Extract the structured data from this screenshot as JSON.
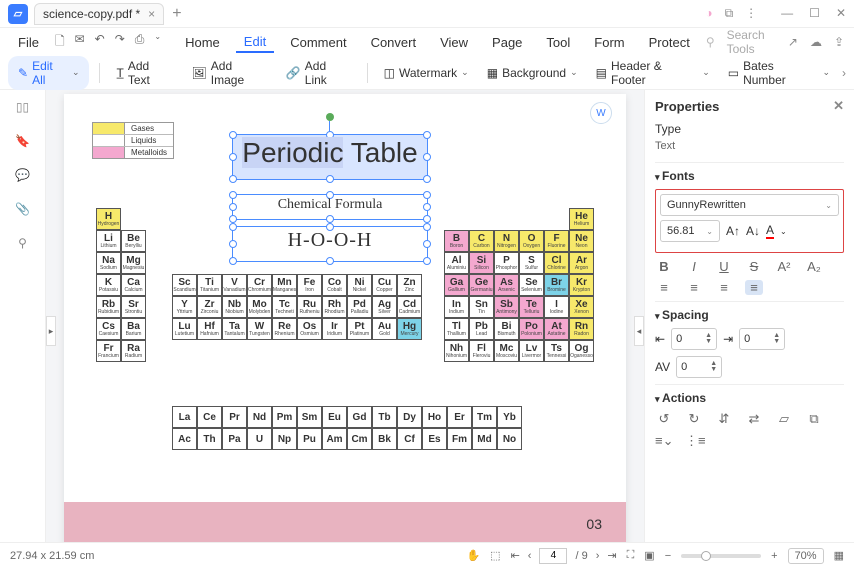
{
  "titlebar": {
    "filename": "science-copy.pdf *"
  },
  "qat": {
    "file": "File"
  },
  "menu": {
    "home": "Home",
    "edit": "Edit",
    "comment": "Comment",
    "convert": "Convert",
    "view": "View",
    "page": "Page",
    "tool": "Tool",
    "form": "Form",
    "protect": "Protect"
  },
  "search": {
    "placeholder": "Search Tools"
  },
  "toolbar": {
    "edit_all": "Edit All",
    "add_text": "Add Text",
    "add_image": "Add Image",
    "add_link": "Add Link",
    "watermark": "Watermark",
    "background": "Background",
    "header_footer": "Header & Footer",
    "bates": "Bates Number"
  },
  "doc": {
    "legend": {
      "gases": "Gases",
      "liquids": "Liquids",
      "metalloids": "Metalloids"
    },
    "title_a": "Periodic",
    "title_b": " Table",
    "subtitle": "Chemical Formula",
    "formula": "H-O-O-H",
    "page_num": "03"
  },
  "props": {
    "title": "Properties",
    "type_lbl": "Type",
    "type_val": "Text",
    "fonts_lbl": "Fonts",
    "font_name": "GunnyRewritten",
    "font_size": "56.81",
    "spacing_lbl": "Spacing",
    "spacing_a": "0",
    "spacing_b": "0",
    "spacing_c": "0",
    "actions_lbl": "Actions"
  },
  "status": {
    "dims": "27.94 x 21.59 cm",
    "page_cur": "4",
    "page_tot": "/ 9",
    "zoom": "70%"
  },
  "chart_data": {
    "type": "table",
    "title": "Periodic Table",
    "legend": [
      {
        "color": "#f7e96b",
        "label": "Gases"
      },
      {
        "color": "#fff",
        "label": "Liquids"
      },
      {
        "color": "#f4a8cf",
        "label": "Metalloids"
      }
    ],
    "elements": [
      {
        "sy": "H",
        "nm": "Hydrogen",
        "g": 1,
        "p": 1,
        "c": "y"
      },
      {
        "sy": "He",
        "nm": "Helium",
        "g": 18,
        "p": 1,
        "c": "y"
      },
      {
        "sy": "Li",
        "nm": "Lithium",
        "g": 1,
        "p": 2
      },
      {
        "sy": "Be",
        "nm": "Beryllium",
        "g": 2,
        "p": 2
      },
      {
        "sy": "B",
        "nm": "Boron",
        "g": 13,
        "p": 2,
        "c": "p"
      },
      {
        "sy": "C",
        "nm": "Carbon",
        "g": 14,
        "p": 2,
        "c": "y"
      },
      {
        "sy": "N",
        "nm": "Nitrogen",
        "g": 15,
        "p": 2,
        "c": "y"
      },
      {
        "sy": "O",
        "nm": "Oxygen",
        "g": 16,
        "p": 2,
        "c": "y"
      },
      {
        "sy": "F",
        "nm": "Fluorine",
        "g": 17,
        "p": 2,
        "c": "y"
      },
      {
        "sy": "Ne",
        "nm": "Neon",
        "g": 18,
        "p": 2,
        "c": "y"
      },
      {
        "sy": "Na",
        "nm": "Sodium",
        "g": 1,
        "p": 3
      },
      {
        "sy": "Mg",
        "nm": "Magnesium",
        "g": 2,
        "p": 3
      },
      {
        "sy": "Al",
        "nm": "Aluminium",
        "g": 13,
        "p": 3
      },
      {
        "sy": "Si",
        "nm": "Silicon",
        "g": 14,
        "p": 3,
        "c": "p"
      },
      {
        "sy": "P",
        "nm": "Phosphorus",
        "g": 15,
        "p": 3
      },
      {
        "sy": "S",
        "nm": "Sulfur",
        "g": 16,
        "p": 3
      },
      {
        "sy": "Cl",
        "nm": "Chlorine",
        "g": 17,
        "p": 3,
        "c": "y"
      },
      {
        "sy": "Ar",
        "nm": "Argon",
        "g": 18,
        "p": 3,
        "c": "y"
      },
      {
        "sy": "K",
        "nm": "Potassium",
        "g": 1,
        "p": 4
      },
      {
        "sy": "Ca",
        "nm": "Calcium",
        "g": 2,
        "p": 4
      },
      {
        "sy": "Sc",
        "nm": "Scandium",
        "g": 3,
        "p": 4
      },
      {
        "sy": "Ti",
        "nm": "Titanium",
        "g": 4,
        "p": 4
      },
      {
        "sy": "V",
        "nm": "Vanadium",
        "g": 5,
        "p": 4
      },
      {
        "sy": "Cr",
        "nm": "Chromium",
        "g": 6,
        "p": 4
      },
      {
        "sy": "Mn",
        "nm": "Manganese",
        "g": 7,
        "p": 4
      },
      {
        "sy": "Fe",
        "nm": "Iron",
        "g": 8,
        "p": 4
      },
      {
        "sy": "Co",
        "nm": "Cobalt",
        "g": 9,
        "p": 4
      },
      {
        "sy": "Ni",
        "nm": "Nickel",
        "g": 10,
        "p": 4
      },
      {
        "sy": "Cu",
        "nm": "Copper",
        "g": 11,
        "p": 4
      },
      {
        "sy": "Zn",
        "nm": "Zinc",
        "g": 12,
        "p": 4
      },
      {
        "sy": "Ga",
        "nm": "Gallium",
        "g": 13,
        "p": 4,
        "c": "p"
      },
      {
        "sy": "Ge",
        "nm": "Germanium",
        "g": 14,
        "p": 4,
        "c": "p"
      },
      {
        "sy": "As",
        "nm": "Arsenic",
        "g": 15,
        "p": 4,
        "c": "p"
      },
      {
        "sy": "Se",
        "nm": "Selenium",
        "g": 16,
        "p": 4
      },
      {
        "sy": "Br",
        "nm": "Bromine",
        "g": 17,
        "p": 4,
        "c": "b"
      },
      {
        "sy": "Kr",
        "nm": "Krypton",
        "g": 18,
        "p": 4,
        "c": "y"
      },
      {
        "sy": "Rb",
        "nm": "Rubidium",
        "g": 1,
        "p": 5
      },
      {
        "sy": "Sr",
        "nm": "Strontium",
        "g": 2,
        "p": 5
      },
      {
        "sy": "Y",
        "nm": "Yttrium",
        "g": 3,
        "p": 5
      },
      {
        "sy": "Zr",
        "nm": "Zirconium",
        "g": 4,
        "p": 5
      },
      {
        "sy": "Nb",
        "nm": "Niobium",
        "g": 5,
        "p": 5
      },
      {
        "sy": "Mo",
        "nm": "Molybdenum",
        "g": 6,
        "p": 5
      },
      {
        "sy": "Tc",
        "nm": "Technetium",
        "g": 7,
        "p": 5
      },
      {
        "sy": "Ru",
        "nm": "Ruthenium",
        "g": 8,
        "p": 5
      },
      {
        "sy": "Rh",
        "nm": "Rhodium",
        "g": 9,
        "p": 5
      },
      {
        "sy": "Pd",
        "nm": "Palladium",
        "g": 10,
        "p": 5
      },
      {
        "sy": "Ag",
        "nm": "Silver",
        "g": 11,
        "p": 5
      },
      {
        "sy": "Cd",
        "nm": "Cadmium",
        "g": 12,
        "p": 5
      },
      {
        "sy": "In",
        "nm": "Indium",
        "g": 13,
        "p": 5
      },
      {
        "sy": "Sn",
        "nm": "Tin",
        "g": 14,
        "p": 5
      },
      {
        "sy": "Sb",
        "nm": "Antimony",
        "g": 15,
        "p": 5,
        "c": "p"
      },
      {
        "sy": "Te",
        "nm": "Tellurium",
        "g": 16,
        "p": 5,
        "c": "p"
      },
      {
        "sy": "I",
        "nm": "Iodine",
        "g": 17,
        "p": 5
      },
      {
        "sy": "Xe",
        "nm": "Xenon",
        "g": 18,
        "p": 5,
        "c": "y"
      },
      {
        "sy": "Cs",
        "nm": "Caesium",
        "g": 1,
        "p": 6
      },
      {
        "sy": "Ba",
        "nm": "Barium",
        "g": 2,
        "p": 6
      },
      {
        "sy": "Lu",
        "nm": "Lutetium",
        "g": 3,
        "p": 6
      },
      {
        "sy": "Hf",
        "nm": "Hafnium",
        "g": 4,
        "p": 6
      },
      {
        "sy": "Ta",
        "nm": "Tantalum",
        "g": 5,
        "p": 6
      },
      {
        "sy": "W",
        "nm": "Tungsten",
        "g": 6,
        "p": 6
      },
      {
        "sy": "Re",
        "nm": "Rhenium",
        "g": 7,
        "p": 6
      },
      {
        "sy": "Os",
        "nm": "Osmium",
        "g": 8,
        "p": 6
      },
      {
        "sy": "Ir",
        "nm": "Iridium",
        "g": 9,
        "p": 6
      },
      {
        "sy": "Pt",
        "nm": "Platinum",
        "g": 10,
        "p": 6
      },
      {
        "sy": "Au",
        "nm": "Gold",
        "g": 11,
        "p": 6
      },
      {
        "sy": "Hg",
        "nm": "Mercury",
        "g": 12,
        "p": 6,
        "c": "b"
      },
      {
        "sy": "Tl",
        "nm": "Thallium",
        "g": 13,
        "p": 6
      },
      {
        "sy": "Pb",
        "nm": "Lead",
        "g": 14,
        "p": 6
      },
      {
        "sy": "Bi",
        "nm": "Bismuth",
        "g": 15,
        "p": 6
      },
      {
        "sy": "Po",
        "nm": "Polonium",
        "g": 16,
        "p": 6,
        "c": "p"
      },
      {
        "sy": "At",
        "nm": "Astatine",
        "g": 17,
        "p": 6,
        "c": "p"
      },
      {
        "sy": "Rn",
        "nm": "Radon",
        "g": 18,
        "p": 6,
        "c": "y"
      },
      {
        "sy": "Fr",
        "nm": "Francium",
        "g": 1,
        "p": 7
      },
      {
        "sy": "Ra",
        "nm": "Radium",
        "g": 2,
        "p": 7
      },
      {
        "sy": "Nh",
        "nm": "Nihonium",
        "g": 13,
        "p": 7
      },
      {
        "sy": "Fl",
        "nm": "Flerovium",
        "g": 14,
        "p": 7
      },
      {
        "sy": "Mc",
        "nm": "Moscovium",
        "g": 15,
        "p": 7
      },
      {
        "sy": "Lv",
        "nm": "Livermorium",
        "g": 16,
        "p": 7
      },
      {
        "sy": "Ts",
        "nm": "Tennessine",
        "g": 17,
        "p": 7
      },
      {
        "sy": "Og",
        "nm": "Oganesson",
        "g": 18,
        "p": 7
      }
    ],
    "lanth": [
      "La",
      "Ce",
      "Pr",
      "Nd",
      "Pm",
      "Sm",
      "Eu",
      "Gd",
      "Tb",
      "Dy",
      "Ho",
      "Er",
      "Tm",
      "Yb"
    ],
    "act": [
      "Ac",
      "Th",
      "Pa",
      "U",
      "Np",
      "Pu",
      "Am",
      "Cm",
      "Bk",
      "Cf",
      "Es",
      "Fm",
      "Md",
      "No"
    ]
  }
}
